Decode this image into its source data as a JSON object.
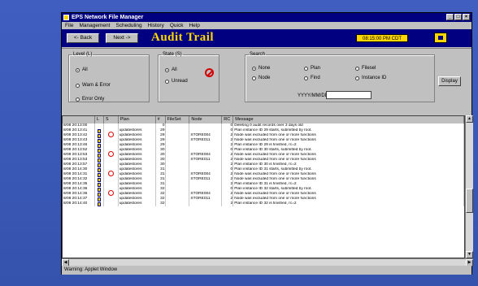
{
  "window": {
    "title": "EPS Network File Manager"
  },
  "menu": [
    "File",
    "Management",
    "Scheduling",
    "History",
    "Quick",
    "Help"
  ],
  "toolbar": {
    "back": "<- Back",
    "next": "Next ->",
    "title": "Audit Trail",
    "clock": "08:15:00 PM CDT"
  },
  "level": {
    "legend": "Level (L)",
    "options": [
      {
        "label": "All",
        "selected": true
      },
      {
        "label": "Warn & Error",
        "selected": false
      },
      {
        "label": "Error Only",
        "selected": false
      }
    ]
  },
  "state": {
    "legend": "State (S)",
    "options": [
      {
        "label": "All",
        "selected": true
      },
      {
        "label": "Unread",
        "selected": false
      }
    ]
  },
  "search": {
    "legend": "Search",
    "options": [
      {
        "label": "None",
        "selected": true
      },
      {
        "label": "Plan",
        "selected": false
      },
      {
        "label": "Filesel",
        "selected": false
      },
      {
        "label": "Node",
        "selected": false
      },
      {
        "label": "Find",
        "selected": false
      },
      {
        "label": "Instance ID",
        "selected": false
      }
    ],
    "date_label": "YYYY/MM/DD",
    "date_value": ""
  },
  "display_button": "Display",
  "table": {
    "columns": [
      "",
      "L",
      "S",
      "Plan",
      "#",
      "FileSet",
      "Node",
      "RC",
      "Message"
    ],
    "rows": [
      {
        "time": "8/08 20:13:00",
        "plan": "",
        "num": "0",
        "node": "",
        "rc": "0",
        "msg": "Deleting 0 audit records over 3 days old",
        "icons": ""
      },
      {
        "time": "8/08 20:13:41",
        "plan": "updatestores",
        "num": "29",
        "node": "",
        "rc": "0",
        "msg": "Plan instance ID 29 starts, submitted by root.",
        "icons": "lock"
      },
      {
        "time": "8/08 20:13:42",
        "plan": "updatestores",
        "num": "29",
        "node": "STORE004",
        "rc": "2",
        "msg": "Node was excluded from one or more functions",
        "icons": "lock bad"
      },
      {
        "time": "8/08 20:13:43",
        "plan": "updatestores",
        "num": "29",
        "node": "STORE011",
        "rc": "2",
        "msg": "Node was excluded from one or more functions",
        "icons": "lock"
      },
      {
        "time": "8/08 20:13:46",
        "plan": "updatestores",
        "num": "29",
        "node": "",
        "rc": "2",
        "msg": "Plan instance ID 29 is finished, rc=2",
        "icons": "lock"
      },
      {
        "time": "8/08 20:13:52",
        "plan": "updatestores",
        "num": "30",
        "node": "",
        "rc": "0",
        "msg": "Plan instance ID 30 starts, submitted by root.",
        "icons": "lock"
      },
      {
        "time": "8/08 20:13:53",
        "plan": "updatestores",
        "num": "30",
        "node": "STORE004",
        "rc": "2",
        "msg": "Node was excluded from one or more functions",
        "icons": "lock bad"
      },
      {
        "time": "8/08 20:13:53",
        "plan": "updatestores",
        "num": "30",
        "node": "STORE011",
        "rc": "2",
        "msg": "Node was excluded from one or more functions",
        "icons": "lock"
      },
      {
        "time": "8/08 20:13:57",
        "plan": "updatestores",
        "num": "30",
        "node": "",
        "rc": "2",
        "msg": "Plan instance ID 30 is finished, rc=2",
        "icons": "lock"
      },
      {
        "time": "8/08 20:14:30",
        "plan": "updatestores",
        "num": "31",
        "node": "",
        "rc": "0",
        "msg": "Plan instance ID 31 starts, submitted by root.",
        "icons": "lock"
      },
      {
        "time": "8/08 20:14:31",
        "plan": "updatestores",
        "num": "31",
        "node": "STORE004",
        "rc": "2",
        "msg": "Node was excluded from one or more functions",
        "icons": "lock bad"
      },
      {
        "time": "8/08 20:14:32",
        "plan": "updatestores",
        "num": "31",
        "node": "STORE011",
        "rc": "2",
        "msg": "Node was excluded from one or more functions",
        "icons": "lock"
      },
      {
        "time": "8/08 20:14:35",
        "plan": "updatestores",
        "num": "31",
        "node": "",
        "rc": "2",
        "msg": "Plan instance ID 31 is finished, rc=2",
        "icons": "lock"
      },
      {
        "time": "8/08 20:14:36",
        "plan": "updatestores",
        "num": "32",
        "node": "",
        "rc": "0",
        "msg": "Plan instance ID 32 starts, submitted by root.",
        "icons": "lock"
      },
      {
        "time": "8/08 20:14:36",
        "plan": "updatestores",
        "num": "32",
        "node": "STORE004",
        "rc": "2",
        "msg": "Node was excluded from one or more functions",
        "icons": "lock bad"
      },
      {
        "time": "8/08 20:14:37",
        "plan": "updatestores",
        "num": "32",
        "node": "STORE011",
        "rc": "2",
        "msg": "Node was excluded from one or more functions",
        "icons": "lock"
      },
      {
        "time": "8/08 20:14:40",
        "plan": "updatestores",
        "num": "32",
        "node": "",
        "rc": "2",
        "msg": "Plan instance ID 32 is finished, rc=2",
        "icons": "lock"
      }
    ]
  },
  "status_bar": "Warning: Applet Window",
  "colors": {
    "desktop": "#3f5ec0",
    "toolbar": "#000080",
    "accent": "#ffd700",
    "error": "#e00000"
  }
}
